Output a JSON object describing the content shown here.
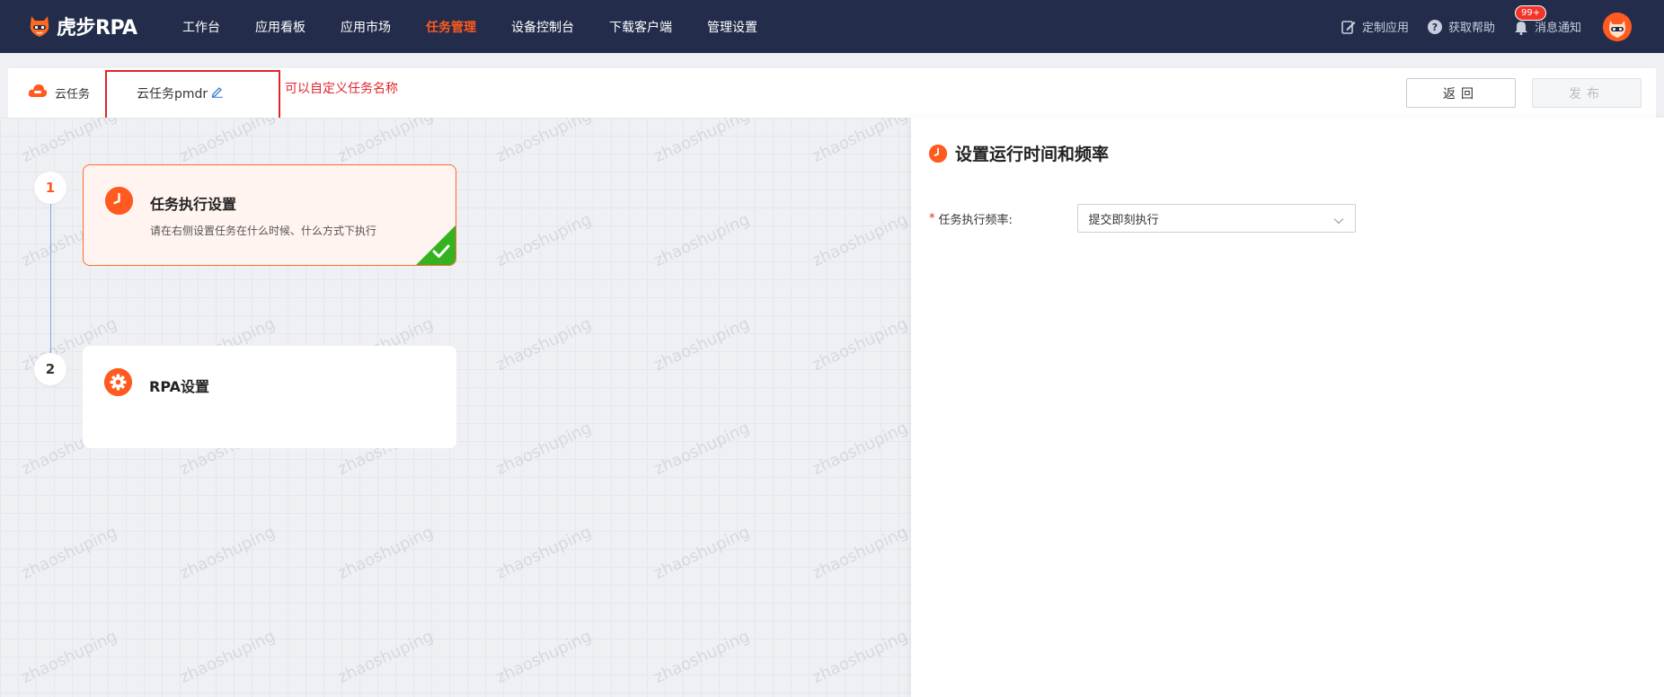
{
  "brand": {
    "logo_text": "虎步RPA",
    "accent_color": "#ff5a1f",
    "nav_bg_color": "#232d4b"
  },
  "nav": {
    "items": [
      {
        "label": "工作台",
        "active": false
      },
      {
        "label": "应用看板",
        "active": false
      },
      {
        "label": "应用市场",
        "active": false
      },
      {
        "label": "任务管理",
        "active": true
      },
      {
        "label": "设备控制台",
        "active": false
      },
      {
        "label": "下载客户端",
        "active": false
      },
      {
        "label": "管理设置",
        "active": false
      }
    ]
  },
  "top_right": {
    "custom_app": {
      "label": "定制应用",
      "icon": "edit-icon"
    },
    "help": {
      "label": "获取帮助",
      "icon": "question-icon"
    },
    "notifications": {
      "label": "消息通知",
      "icon": "bell-icon",
      "badge": "99+"
    },
    "avatar": {
      "icon": "avatar-icon"
    }
  },
  "subheader": {
    "section_label": "云任务",
    "section_icon": "cloud-icon",
    "task_name": "云任务pmdr",
    "edit_icon": "pencil-icon",
    "annotation": "可以自定义任务名称",
    "back_label": "返回",
    "publish_label": "发布"
  },
  "watermark": "zhaoshuping",
  "steps": [
    {
      "number": "1",
      "title": "任务执行设置",
      "description": "请在右侧设置任务在什么时候、什么方式下执行",
      "icon": "clock-icon",
      "active": true,
      "completed": true
    },
    {
      "number": "2",
      "title": "RPA设置",
      "description": "",
      "icon": "gear-icon",
      "active": false,
      "completed": false
    }
  ],
  "panel": {
    "title": "设置运行时间和频率",
    "icon": "clock-icon",
    "fields": [
      {
        "required_mark": "*",
        "label": "任务执行频率:",
        "value": "提交即刻执行",
        "control": "select"
      }
    ]
  }
}
